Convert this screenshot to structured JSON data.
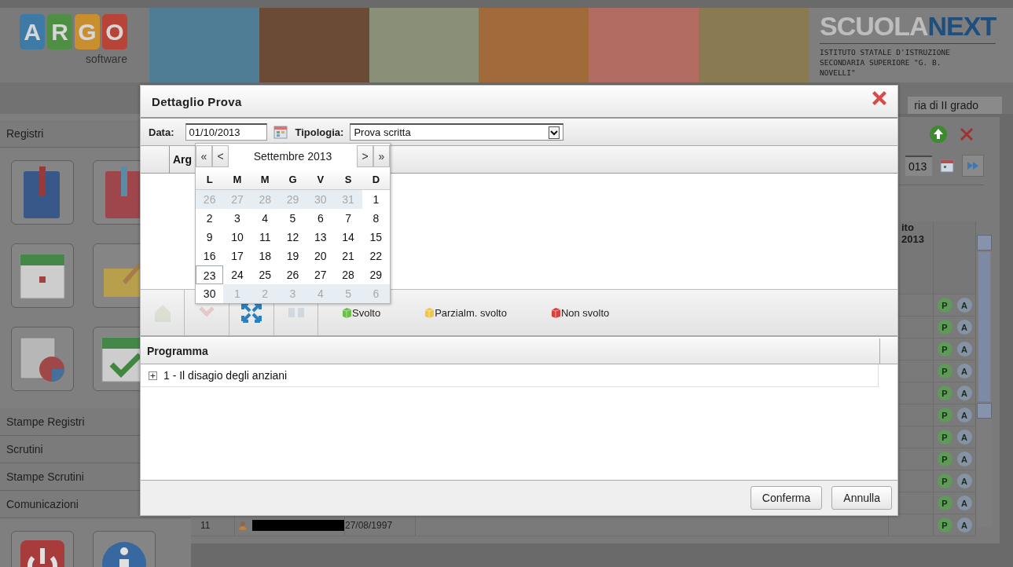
{
  "header": {
    "logo_letters": [
      {
        "text": "A",
        "color": "#3d7aa6"
      },
      {
        "text": "R",
        "color": "#4e8f44"
      },
      {
        "text": "G",
        "color": "#c98f2e"
      },
      {
        "text": "O",
        "color": "#b84437"
      }
    ],
    "logo_subtitle": "software",
    "product_first": "SCUOLA",
    "product_second": "NEXT",
    "school_lines": [
      "ISTITUTO STATALE D'ISTRUZIONE",
      "SECONDARIA SUPERIORE \"G. B.",
      "NOVELLI\""
    ],
    "school_type": "ria di II grado"
  },
  "sidebar": {
    "top_section": "Registri",
    "sections": [
      "Stampe Registri",
      "Scrutini",
      "Stampe Scrutini",
      "Comunicazioni"
    ]
  },
  "main_panel": {
    "date_value": "013",
    "column_header": [
      "ito",
      "2013"
    ],
    "rows": [
      {
        "badges": [
          "P",
          "A"
        ]
      },
      {
        "badges": [
          "P",
          "A"
        ]
      },
      {
        "badges": [
          "P",
          "A"
        ]
      },
      {
        "badges": [
          "P",
          "A"
        ]
      },
      {
        "badges": [
          "P",
          "A"
        ]
      },
      {
        "badges": [
          "P",
          "A"
        ]
      },
      {
        "badges": [
          "P",
          "A"
        ]
      },
      {
        "badges": [
          "P",
          "A"
        ]
      },
      {
        "badges": [
          "P",
          "A"
        ]
      },
      {
        "badges": [
          "P",
          "A"
        ]
      },
      {
        "number": "11",
        "birth_date": "27/08/1997",
        "badges": [
          "P",
          "A"
        ]
      }
    ]
  },
  "dialog": {
    "title": "Dettaglio Prova",
    "date_label": "Data:",
    "date_value": "01/10/2013",
    "type_label": "Tipologia:",
    "type_value": "Prova scritta",
    "grid_header": "Arg",
    "tool_buttons": [
      {
        "disabled": true
      },
      {
        "disabled": true
      },
      {
        "disabled": false
      },
      {
        "disabled": true
      }
    ],
    "legend": [
      {
        "label": "Svolto",
        "color": "#6cbf4a"
      },
      {
        "label": "Parzialm. svolto",
        "color": "#efc64a"
      },
      {
        "label": "Non svolto",
        "color": "#d8403a"
      }
    ],
    "program_header": "Programma",
    "program_items": [
      {
        "text": "1 - Il disagio degli anziani",
        "expanded": false
      }
    ],
    "buttons": [
      "Conferma",
      "Annulla"
    ]
  },
  "calendar": {
    "prev_year": "«",
    "prev_month": "<",
    "month": "Settembre 2013",
    "next_month": ">",
    "next_year": "»",
    "weekdays": [
      "L",
      "M",
      "M",
      "G",
      "V",
      "S",
      "D"
    ],
    "weeks": [
      [
        {
          "day": "26",
          "other_month": true
        },
        {
          "day": "27",
          "other_month": true
        },
        {
          "day": "28",
          "other_month": true
        },
        {
          "day": "29",
          "other_month": true
        },
        {
          "day": "30",
          "other_month": true
        },
        {
          "day": "31",
          "other_month": true
        },
        {
          "day": "1",
          "other_month": false
        }
      ],
      [
        {
          "day": "2",
          "other_month": false
        },
        {
          "day": "3",
          "other_month": false
        },
        {
          "day": "4",
          "other_month": false
        },
        {
          "day": "5",
          "other_month": false
        },
        {
          "day": "6",
          "other_month": false
        },
        {
          "day": "7",
          "other_month": false
        },
        {
          "day": "8",
          "other_month": false
        }
      ],
      [
        {
          "day": "9",
          "other_month": false
        },
        {
          "day": "10",
          "other_month": false
        },
        {
          "day": "11",
          "other_month": false
        },
        {
          "day": "12",
          "other_month": false
        },
        {
          "day": "13",
          "other_month": false
        },
        {
          "day": "14",
          "other_month": false
        },
        {
          "day": "15",
          "other_month": false
        }
      ],
      [
        {
          "day": "16",
          "other_month": false
        },
        {
          "day": "17",
          "other_month": false
        },
        {
          "day": "18",
          "other_month": false
        },
        {
          "day": "19",
          "other_month": false
        },
        {
          "day": "20",
          "other_month": false
        },
        {
          "day": "21",
          "other_month": false
        },
        {
          "day": "22",
          "other_month": false
        }
      ],
      [
        {
          "day": "23",
          "other_month": false,
          "today": true
        },
        {
          "day": "24",
          "other_month": false
        },
        {
          "day": "25",
          "other_month": false
        },
        {
          "day": "26",
          "other_month": false
        },
        {
          "day": "27",
          "other_month": false
        },
        {
          "day": "28",
          "other_month": false
        },
        {
          "day": "29",
          "other_month": false
        }
      ],
      [
        {
          "day": "30",
          "other_month": false
        },
        {
          "day": "1",
          "other_month": true
        },
        {
          "day": "2",
          "other_month": true
        },
        {
          "day": "3",
          "other_month": true
        },
        {
          "day": "4",
          "other_month": true
        },
        {
          "day": "5",
          "other_month": true
        },
        {
          "day": "6",
          "other_month": true
        }
      ]
    ]
  }
}
